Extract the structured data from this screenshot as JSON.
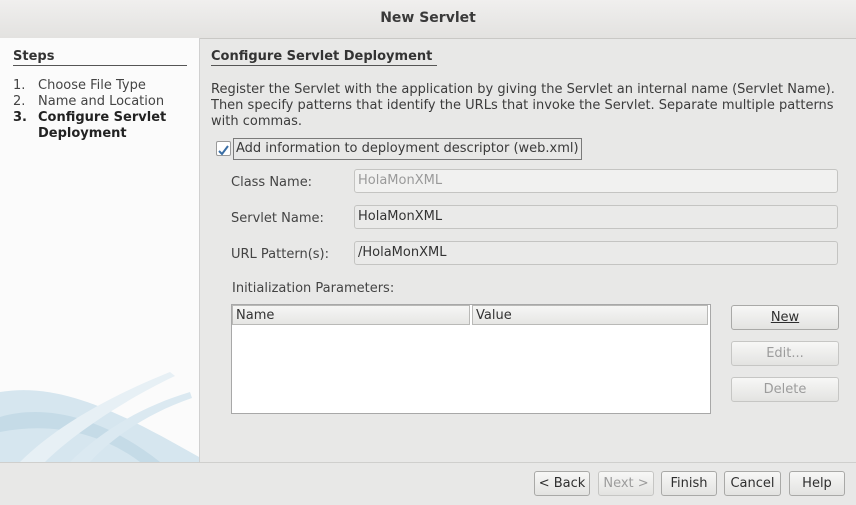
{
  "window": {
    "title": "New Servlet"
  },
  "steps": {
    "title": "Steps",
    "items": [
      {
        "num": "1.",
        "label": "Choose File Type"
      },
      {
        "num": "2.",
        "label": "Name and Location"
      },
      {
        "num": "3.",
        "label": "Configure Servlet",
        "label2": "Deployment"
      }
    ]
  },
  "main": {
    "heading": "Configure Servlet Deployment",
    "description": "Register the Servlet with the application by giving the Servlet an internal name (Servlet Name). Then specify patterns that identify the URLs that invoke the Servlet. Separate multiple patterns with commas.",
    "checkbox": {
      "label": "Add information to deployment descriptor (web.xml)",
      "checked": true
    },
    "class_name": {
      "label": "Class Name:",
      "value": "HolaMonXML"
    },
    "servlet_name": {
      "label": "Servlet Name:",
      "value": "HolaMonXML"
    },
    "url_pattern": {
      "label": "URL Pattern(s):",
      "value": "/HolaMonXML"
    },
    "init_params": {
      "label": "Initialization Parameters:",
      "columns": [
        "Name",
        "Value"
      ]
    },
    "buttons": {
      "new": "New",
      "edit": "Edit...",
      "delete": "Delete"
    }
  },
  "footer": {
    "back": "< Back",
    "next": "Next >",
    "finish": "Finish",
    "cancel": "Cancel",
    "help": "Help"
  }
}
